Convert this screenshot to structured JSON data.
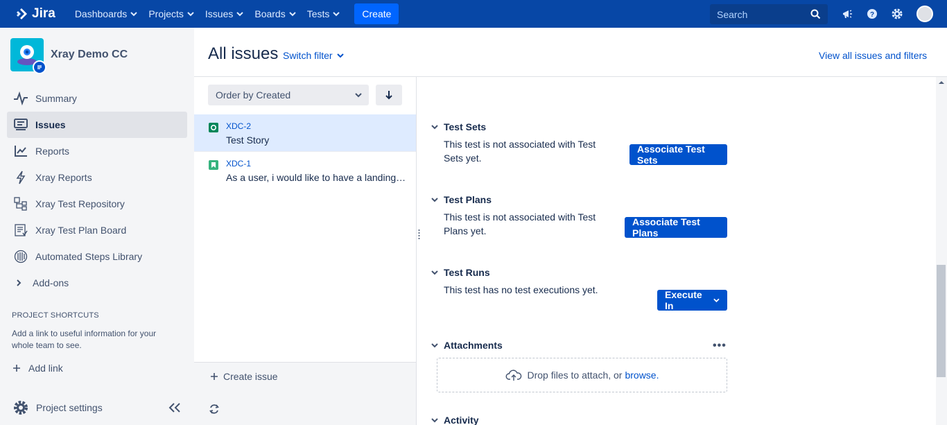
{
  "topnav": {
    "logo_text": "Jira",
    "items": [
      {
        "label": "Dashboards"
      },
      {
        "label": "Projects"
      },
      {
        "label": "Issues"
      },
      {
        "label": "Boards"
      },
      {
        "label": "Tests"
      }
    ],
    "create_label": "Create",
    "search_placeholder": "Search",
    "icons": [
      "notification-icon",
      "help-icon",
      "settings-icon",
      "profile-avatar"
    ]
  },
  "sidebar": {
    "project_name": "Xray Demo CC",
    "items": [
      {
        "label": "Summary",
        "icon": "pulse-icon"
      },
      {
        "label": "Issues",
        "icon": "issues-icon",
        "active": true
      },
      {
        "label": "Reports",
        "icon": "reports-icon"
      },
      {
        "label": "Xray Reports",
        "icon": "lightning-icon"
      },
      {
        "label": "Xray Test Repository",
        "icon": "repository-icon"
      },
      {
        "label": "Xray Test Plan Board",
        "icon": "board-icon"
      },
      {
        "label": "Automated Steps Library",
        "icon": "library-icon"
      },
      {
        "label": "Add-ons",
        "icon": "chevron-right-icon"
      }
    ],
    "shortcuts_title": "PROJECT SHORTCUTS",
    "shortcuts_desc": "Add a link to useful information for your whole team to see.",
    "add_link": "Add link",
    "settings": "Project settings"
  },
  "header": {
    "title": "All issues",
    "switch_filter": "Switch filter",
    "view_all": "View all issues and filters"
  },
  "list": {
    "order_label": "Order by Created",
    "issues": [
      {
        "key": "XDC-2",
        "summary": "Test Story",
        "type_color": "#00875A",
        "selected": true
      },
      {
        "key": "XDC-1",
        "summary": "As a user, i would like to have a landing page",
        "type_color": "#36B37E",
        "selected": false
      }
    ],
    "create_issue": "Create issue"
  },
  "details": {
    "test_sets": {
      "title": "Test Sets",
      "text": "This test is not associated with Test Sets yet.",
      "button": "Associate Test Sets"
    },
    "test_plans": {
      "title": "Test Plans",
      "text": "This test is not associated with Test Plans yet.",
      "button": "Associate Test Plans"
    },
    "test_runs": {
      "title": "Test Runs",
      "text": "This test has no test executions yet.",
      "button": "Execute In"
    },
    "attachments": {
      "title": "Attachments",
      "drop_text": "Drop files to attach, or",
      "browse": "browse."
    },
    "activity": {
      "title": "Activity"
    }
  },
  "colors": {
    "topnav_bg": "#0747A6",
    "primary_button": "#0052CC",
    "link": "#0052CC",
    "selected_row": "#DEEBFF",
    "sidebar_bg": "#F4F5F7"
  }
}
